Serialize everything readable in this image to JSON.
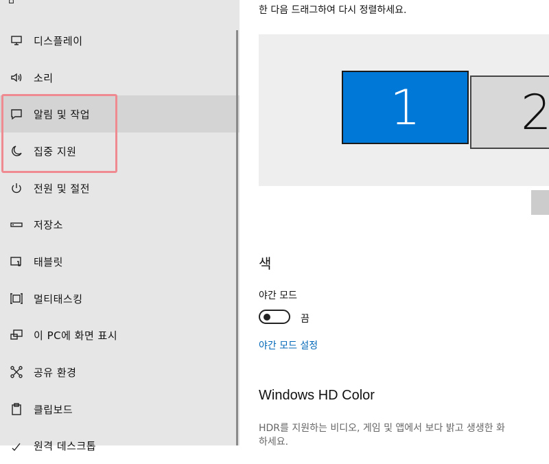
{
  "sidebar": {
    "items": [
      {
        "label": "디스플레이",
        "icon": "monitor-icon"
      },
      {
        "label": "소리",
        "icon": "speaker-icon"
      },
      {
        "label": "알림 및 작업",
        "icon": "notification-icon"
      },
      {
        "label": "집중 지원",
        "icon": "moon-icon"
      },
      {
        "label": "전원 및 절전",
        "icon": "power-icon"
      },
      {
        "label": "저장소",
        "icon": "storage-icon"
      },
      {
        "label": "태블릿",
        "icon": "tablet-icon"
      },
      {
        "label": "멀티태스킹",
        "icon": "multitasking-icon"
      },
      {
        "label": "이 PC에 화면 표시",
        "icon": "project-icon"
      },
      {
        "label": "공유 환경",
        "icon": "shared-experiences-icon"
      },
      {
        "label": "클립보드",
        "icon": "clipboard-icon"
      },
      {
        "label": "원격 데스크톱",
        "icon": "remote-desktop-icon"
      }
    ],
    "selected": "알림 및 작업"
  },
  "main": {
    "instruction": "한 다음 드래그하여 다시 정렬하세요.",
    "monitors": [
      "1",
      "2"
    ],
    "color_section": "색",
    "night_light_label": "야간 모드",
    "night_light_state": "끔",
    "night_light_on": false,
    "night_light_link": "야간 모드 설정",
    "hd_title": "Windows HD Color",
    "hdr_description_line1": "HDR를 지원하는 비디오, 게임 및 앱에서 보다 밝고 생생한 화",
    "hdr_description_line2": "하세요."
  },
  "colors": {
    "accent": "#0078d7",
    "link": "#0067b8",
    "highlight_box": "#ee8a90"
  }
}
